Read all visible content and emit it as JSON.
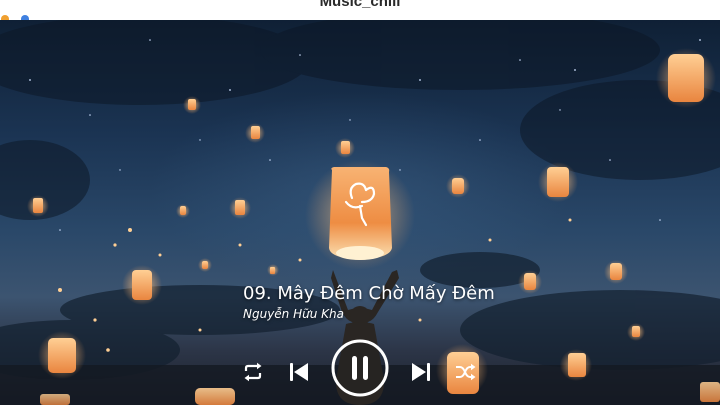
{
  "window": {
    "title": "Music_chill"
  },
  "track": {
    "title": "09. Mây Đêm Chờ Mấy Đêm",
    "artist": "Nguyễn Hữu Kha"
  },
  "player": {
    "is_playing": true,
    "controls": [
      "repeat-icon",
      "previous-icon",
      "pause-icon",
      "next-icon",
      "shuffle-icon"
    ]
  },
  "colors": {
    "sky_top": "#0f2035",
    "sky_mid": "#2a4869",
    "lantern_glow": "#f6a45c",
    "text": "#ffffff"
  }
}
